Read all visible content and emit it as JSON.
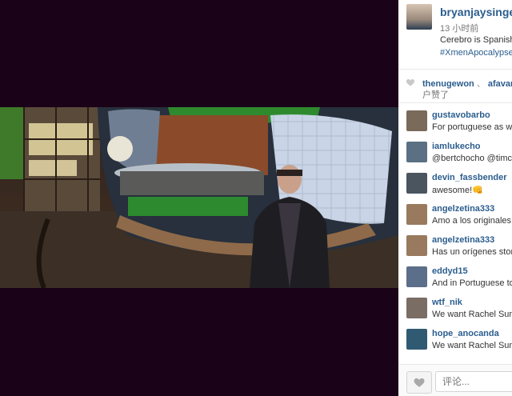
{
  "post": {
    "username": "bryanjaysinger",
    "time_ago": "13 小时前",
    "caption": "Cerebro is Spanish",
    "hashtag": "#XmenApocalypse"
  },
  "likes": {
    "names": [
      "thenugewon",
      "afavare"
    ],
    "separator": "、",
    "suffix": "户赞了"
  },
  "comments": [
    {
      "user": "gustavobarbo",
      "text": "For portuguese as well",
      "avatar_color": "#7a6a5a"
    },
    {
      "user": "iamlukecho",
      "text": "@bertchocho @timchocho",
      "avatar_color": "#5b7083"
    },
    {
      "user": "devin_fassbender",
      "text": "awesome!👊",
      "avatar_color": "#4a5560"
    },
    {
      "user": "angelzetina333",
      "text": "Amo a los originales",
      "avatar_color": "#9a7a5e"
    },
    {
      "user": "angelzetina333",
      "text": "Has un orígenes storm",
      "avatar_color": "#9a7a5e"
    },
    {
      "user": "eddyd15",
      "text": "And in Portuguese too",
      "avatar_color": "#5c6f8a"
    },
    {
      "user": "wtf_nik",
      "text": "We want Rachel Summers",
      "avatar_color": "#7a6d64"
    },
    {
      "user": "hope_anocanda",
      "text": "We want Rachel Summers",
      "avatar_color": "#2f5a72"
    }
  ],
  "comment_box": {
    "placeholder": "评论..."
  },
  "icons": {
    "heart": "heart-icon"
  }
}
